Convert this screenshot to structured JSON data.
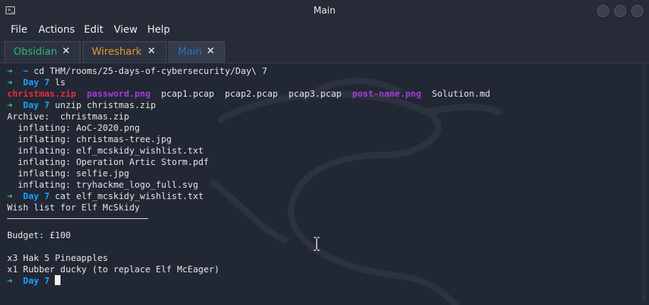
{
  "window": {
    "title": "Main"
  },
  "menu": [
    "File",
    "Actions",
    "Edit",
    "View",
    "Help"
  ],
  "tabs": [
    {
      "label": "Obsidian",
      "color": "#2bb57a",
      "active": false
    },
    {
      "label": "Wireshark",
      "color": "#e09a28",
      "active": false
    },
    {
      "label": "Main",
      "color": "#2d74c8",
      "active": true
    }
  ],
  "terminal": {
    "colors": {
      "prompt_arrow": "#35d07f",
      "directory": "#1aa1ff",
      "archive": "#e0303a",
      "image": "#a43bd8",
      "text": "#e4e4e4"
    },
    "lines": [
      {
        "type": "prompt",
        "dir": "~",
        "cmd": "cd THM/rooms/25-days-of-cybersecurity/Day\\ 7"
      },
      {
        "type": "prompt",
        "dir": "Day 7",
        "cmd": "ls"
      },
      {
        "type": "ls",
        "items": [
          {
            "text": "christmas.zip",
            "kind": "archive"
          },
          {
            "text": "password.png",
            "kind": "image"
          },
          {
            "text": "pcap1.pcap",
            "kind": "file"
          },
          {
            "text": "pcap2.pcap",
            "kind": "file"
          },
          {
            "text": "pcap3.pcap",
            "kind": "file"
          },
          {
            "text": "post-name.png",
            "kind": "image"
          },
          {
            "text": "Solution.md",
            "kind": "file"
          }
        ]
      },
      {
        "type": "prompt",
        "dir": "Day 7",
        "cmd": "unzip christmas.zip"
      },
      {
        "type": "out",
        "text": "Archive:  christmas.zip"
      },
      {
        "type": "out",
        "text": "  inflating: AoC-2020.png"
      },
      {
        "type": "out",
        "text": "  inflating: christmas-tree.jpg"
      },
      {
        "type": "out",
        "text": "  inflating: elf_mcskidy_wishlist.txt"
      },
      {
        "type": "out",
        "text": "  inflating: Operation Artic Storm.pdf"
      },
      {
        "type": "out",
        "text": "  inflating: selfie.jpg"
      },
      {
        "type": "out",
        "text": "  inflating: tryhackme_logo_full.svg"
      },
      {
        "type": "prompt",
        "dir": "Day 7",
        "cmd": "cat elf_mcskidy_wishlist.txt"
      },
      {
        "type": "out",
        "text": "Wish list for Elf McSkidy"
      },
      {
        "type": "rule"
      },
      {
        "type": "out",
        "text": "Budget: £100"
      },
      {
        "type": "out",
        "text": ""
      },
      {
        "type": "out",
        "text": "x3 Hak 5 Pineapples"
      },
      {
        "type": "out",
        "text": "x1 Rubber ducky (to replace Elf McEager)"
      },
      {
        "type": "prompt",
        "dir": "Day 7",
        "cmd": "",
        "cursor": true
      }
    ]
  }
}
